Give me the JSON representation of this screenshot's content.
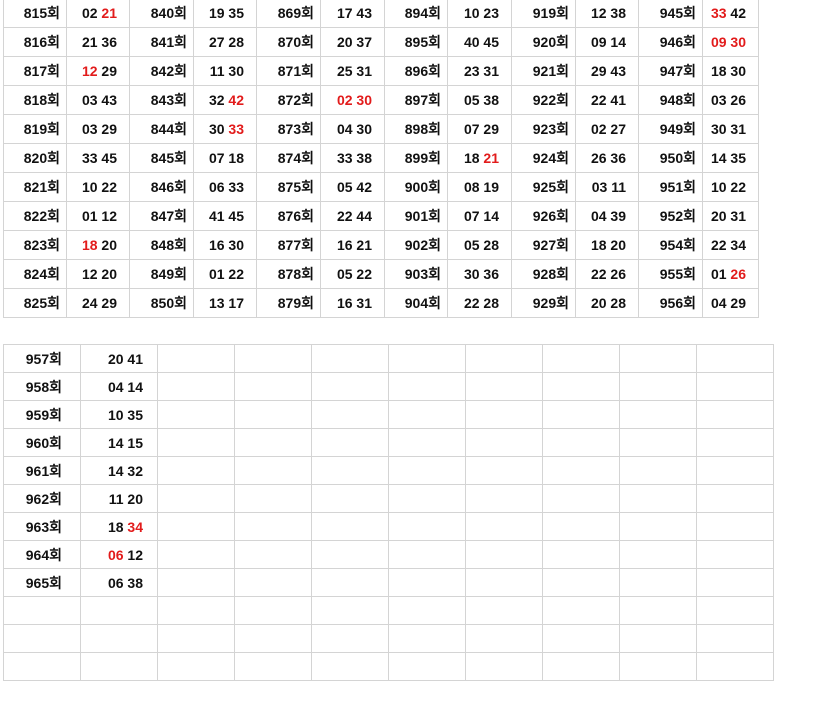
{
  "accent_color": "#e21b1b",
  "top_rows": [
    [
      {
        "r": "815회",
        "n": [
          {
            "t": "02"
          },
          {
            "t": "21",
            "hl": true
          }
        ]
      },
      {
        "r": "840회",
        "n": [
          {
            "t": "19"
          },
          {
            "t": "35"
          }
        ]
      },
      {
        "r": "869회",
        "n": [
          {
            "t": "17"
          },
          {
            "t": "43"
          }
        ]
      },
      {
        "r": "894회",
        "n": [
          {
            "t": "10"
          },
          {
            "t": "23"
          }
        ]
      },
      {
        "r": "919회",
        "n": [
          {
            "t": "12"
          },
          {
            "t": "38"
          }
        ]
      },
      {
        "r": "945회",
        "n": [
          {
            "t": "33",
            "hl": true
          },
          {
            "t": "42"
          }
        ]
      }
    ],
    [
      {
        "r": "816회",
        "n": [
          {
            "t": "21"
          },
          {
            "t": "36"
          }
        ]
      },
      {
        "r": "841회",
        "n": [
          {
            "t": "27"
          },
          {
            "t": "28"
          }
        ]
      },
      {
        "r": "870회",
        "n": [
          {
            "t": "20"
          },
          {
            "t": "37"
          }
        ]
      },
      {
        "r": "895회",
        "n": [
          {
            "t": "40"
          },
          {
            "t": "45"
          }
        ]
      },
      {
        "r": "920회",
        "n": [
          {
            "t": "09"
          },
          {
            "t": "14"
          }
        ]
      },
      {
        "r": "946회",
        "n": [
          {
            "t": "09",
            "hl": true
          },
          {
            "t": "30",
            "hl": true
          }
        ]
      }
    ],
    [
      {
        "r": "817회",
        "n": [
          {
            "t": "12",
            "hl": true
          },
          {
            "t": "29"
          }
        ]
      },
      {
        "r": "842회",
        "n": [
          {
            "t": "11"
          },
          {
            "t": "30"
          }
        ]
      },
      {
        "r": "871회",
        "n": [
          {
            "t": "25"
          },
          {
            "t": "31"
          }
        ]
      },
      {
        "r": "896회",
        "n": [
          {
            "t": "23"
          },
          {
            "t": "31"
          }
        ]
      },
      {
        "r": "921회",
        "n": [
          {
            "t": "29"
          },
          {
            "t": "43"
          }
        ]
      },
      {
        "r": "947회",
        "n": [
          {
            "t": "18"
          },
          {
            "t": "30"
          }
        ]
      }
    ],
    [
      {
        "r": "818회",
        "n": [
          {
            "t": "03"
          },
          {
            "t": "43"
          }
        ]
      },
      {
        "r": "843회",
        "n": [
          {
            "t": "32"
          },
          {
            "t": "42",
            "hl": true
          }
        ]
      },
      {
        "r": "872회",
        "n": [
          {
            "t": "02",
            "hl": true
          },
          {
            "t": "30",
            "hl": true
          }
        ]
      },
      {
        "r": "897회",
        "n": [
          {
            "t": "05"
          },
          {
            "t": "38"
          }
        ]
      },
      {
        "r": "922회",
        "n": [
          {
            "t": "22"
          },
          {
            "t": "41"
          }
        ]
      },
      {
        "r": "948회",
        "n": [
          {
            "t": "03"
          },
          {
            "t": "26"
          }
        ]
      }
    ],
    [
      {
        "r": "819회",
        "n": [
          {
            "t": "03"
          },
          {
            "t": "29"
          }
        ]
      },
      {
        "r": "844회",
        "n": [
          {
            "t": "30"
          },
          {
            "t": "33",
            "hl": true
          }
        ]
      },
      {
        "r": "873회",
        "n": [
          {
            "t": "04"
          },
          {
            "t": "30"
          }
        ]
      },
      {
        "r": "898회",
        "n": [
          {
            "t": "07"
          },
          {
            "t": "29"
          }
        ]
      },
      {
        "r": "923회",
        "n": [
          {
            "t": "02"
          },
          {
            "t": "27"
          }
        ]
      },
      {
        "r": "949회",
        "n": [
          {
            "t": "30"
          },
          {
            "t": "31"
          }
        ]
      }
    ],
    [
      {
        "r": "820회",
        "n": [
          {
            "t": "33"
          },
          {
            "t": "45"
          }
        ]
      },
      {
        "r": "845회",
        "n": [
          {
            "t": "07"
          },
          {
            "t": "18"
          }
        ]
      },
      {
        "r": "874회",
        "n": [
          {
            "t": "33"
          },
          {
            "t": "38"
          }
        ]
      },
      {
        "r": "899회",
        "n": [
          {
            "t": "18"
          },
          {
            "t": "21",
            "hl": true
          }
        ]
      },
      {
        "r": "924회",
        "n": [
          {
            "t": "26"
          },
          {
            "t": "36"
          }
        ]
      },
      {
        "r": "950회",
        "n": [
          {
            "t": "14"
          },
          {
            "t": "35"
          }
        ]
      }
    ],
    [
      {
        "r": "821회",
        "n": [
          {
            "t": "10"
          },
          {
            "t": "22"
          }
        ]
      },
      {
        "r": "846회",
        "n": [
          {
            "t": "06"
          },
          {
            "t": "33"
          }
        ]
      },
      {
        "r": "875회",
        "n": [
          {
            "t": "05"
          },
          {
            "t": "42"
          }
        ]
      },
      {
        "r": "900회",
        "n": [
          {
            "t": "08"
          },
          {
            "t": "19"
          }
        ]
      },
      {
        "r": "925회",
        "n": [
          {
            "t": "03"
          },
          {
            "t": "11"
          }
        ]
      },
      {
        "r": "951회",
        "n": [
          {
            "t": "10"
          },
          {
            "t": "22"
          }
        ]
      }
    ],
    [
      {
        "r": "822회",
        "n": [
          {
            "t": "01"
          },
          {
            "t": "12"
          }
        ]
      },
      {
        "r": "847회",
        "n": [
          {
            "t": "41"
          },
          {
            "t": "45"
          }
        ]
      },
      {
        "r": "876회",
        "n": [
          {
            "t": "22"
          },
          {
            "t": "44"
          }
        ]
      },
      {
        "r": "901회",
        "n": [
          {
            "t": "07"
          },
          {
            "t": "14"
          }
        ]
      },
      {
        "r": "926회",
        "n": [
          {
            "t": "04"
          },
          {
            "t": "39"
          }
        ]
      },
      {
        "r": "952회",
        "n": [
          {
            "t": "20"
          },
          {
            "t": "31"
          }
        ]
      }
    ],
    [
      {
        "r": "823회",
        "n": [
          {
            "t": "18",
            "hl": true
          },
          {
            "t": "20"
          }
        ]
      },
      {
        "r": "848회",
        "n": [
          {
            "t": "16"
          },
          {
            "t": "30"
          }
        ]
      },
      {
        "r": "877회",
        "n": [
          {
            "t": "16"
          },
          {
            "t": "21"
          }
        ]
      },
      {
        "r": "902회",
        "n": [
          {
            "t": "05"
          },
          {
            "t": "28"
          }
        ]
      },
      {
        "r": "927회",
        "n": [
          {
            "t": "18"
          },
          {
            "t": "20"
          }
        ]
      },
      {
        "r": "954회",
        "n": [
          {
            "t": "22"
          },
          {
            "t": "34"
          }
        ]
      }
    ],
    [
      {
        "r": "824회",
        "n": [
          {
            "t": "12"
          },
          {
            "t": "20"
          }
        ]
      },
      {
        "r": "849회",
        "n": [
          {
            "t": "01"
          },
          {
            "t": "22"
          }
        ]
      },
      {
        "r": "878회",
        "n": [
          {
            "t": "05"
          },
          {
            "t": "22"
          }
        ]
      },
      {
        "r": "903회",
        "n": [
          {
            "t": "30"
          },
          {
            "t": "36"
          }
        ]
      },
      {
        "r": "928회",
        "n": [
          {
            "t": "22"
          },
          {
            "t": "26"
          }
        ]
      },
      {
        "r": "955회",
        "n": [
          {
            "t": "01"
          },
          {
            "t": "26",
            "hl": true
          }
        ]
      }
    ],
    [
      {
        "r": "825회",
        "n": [
          {
            "t": "24"
          },
          {
            "t": "29"
          }
        ]
      },
      {
        "r": "850회",
        "n": [
          {
            "t": "13"
          },
          {
            "t": "17"
          }
        ]
      },
      {
        "r": "879회",
        "n": [
          {
            "t": "16"
          },
          {
            "t": "31"
          }
        ]
      },
      {
        "r": "904회",
        "n": [
          {
            "t": "22"
          },
          {
            "t": "28"
          }
        ]
      },
      {
        "r": "929회",
        "n": [
          {
            "t": "20"
          },
          {
            "t": "28"
          }
        ]
      },
      {
        "r": "956회",
        "n": [
          {
            "t": "04"
          },
          {
            "t": "29"
          }
        ]
      }
    ]
  ],
  "bottom_rows": [
    {
      "r": "957회",
      "n": [
        {
          "t": "20"
        },
        {
          "t": "41"
        }
      ]
    },
    {
      "r": "958회",
      "n": [
        {
          "t": "04"
        },
        {
          "t": "14"
        }
      ]
    },
    {
      "r": "959회",
      "n": [
        {
          "t": "10"
        },
        {
          "t": "35"
        }
      ]
    },
    {
      "r": "960회",
      "n": [
        {
          "t": "14"
        },
        {
          "t": "15"
        }
      ]
    },
    {
      "r": "961회",
      "n": [
        {
          "t": "14"
        },
        {
          "t": "32"
        }
      ]
    },
    {
      "r": "962회",
      "n": [
        {
          "t": "11"
        },
        {
          "t": "20"
        }
      ]
    },
    {
      "r": "963회",
      "n": [
        {
          "t": "18"
        },
        {
          "t": "34",
          "hl": true
        }
      ]
    },
    {
      "r": "964회",
      "n": [
        {
          "t": "06",
          "hl": true
        },
        {
          "t": "12"
        }
      ]
    },
    {
      "r": "965회",
      "n": [
        {
          "t": "06"
        },
        {
          "t": "38"
        }
      ]
    },
    {
      "r": "",
      "n": []
    },
    {
      "r": "",
      "n": []
    },
    {
      "r": "",
      "n": []
    }
  ]
}
